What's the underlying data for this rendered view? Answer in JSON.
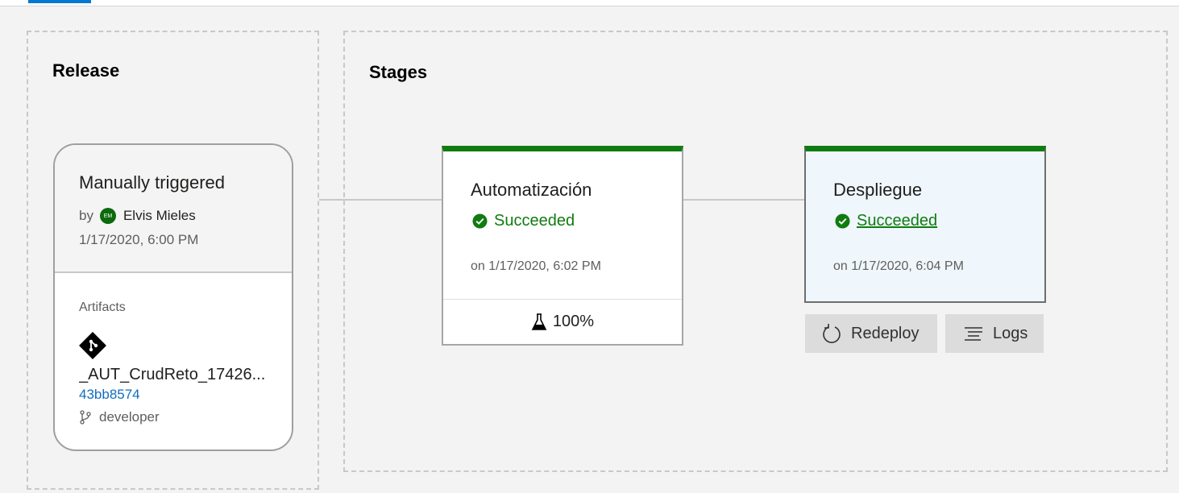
{
  "release": {
    "title": "Release",
    "trigger_title": "Manually triggered",
    "by_label": "by",
    "user_initials": "EM",
    "user_name": "Elvis Mieles",
    "trigger_date": "1/17/2020, 6:00 PM",
    "artifacts_label": "Artifacts",
    "artifact_name": "_AUT_CrudReto_17426...",
    "commit": "43bb8574",
    "branch": "developer"
  },
  "stages": {
    "title": "Stages",
    "items": [
      {
        "name": "Automatización",
        "status": "Succeeded",
        "date": "on 1/17/2020, 6:02 PM",
        "test_pass": "100%"
      },
      {
        "name": "Despliegue",
        "status": "Succeeded",
        "date": "on 1/17/2020, 6:04 PM"
      }
    ],
    "actions": {
      "redeploy": "Redeploy",
      "logs": "Logs"
    }
  },
  "colors": {
    "success": "#107c10",
    "accent": "#0078d4",
    "link": "#106ebe",
    "avatar_bg": "#0b6a0b"
  },
  "icons": [
    "git-icon",
    "branch-icon",
    "check-circle-icon",
    "flask-icon",
    "redeploy-icon",
    "logs-icon"
  ]
}
